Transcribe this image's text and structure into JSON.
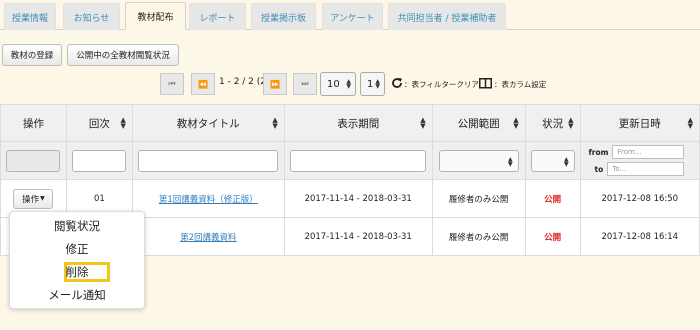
{
  "tabs": [
    "授業情報",
    "お知らせ",
    "教材配布",
    "レポート",
    "授業掲示板",
    "アンケート",
    "共同担当者 / 授業補助者"
  ],
  "toolbar": {
    "register_label": "教材の登録",
    "view_status_label": "公開中の全教材閲覧状況"
  },
  "pager": {
    "first": "⏮",
    "prev": "⏪",
    "range": "1 - 2 / 2 (2)",
    "next": "⏩",
    "last": "⏭",
    "per_page": "10",
    "page": "1",
    "filter_clear": "：表フィルタークリア",
    "column_settings": "：表カラム設定"
  },
  "table": {
    "headers": [
      "操作",
      "回次",
      "教材タイトル",
      "表示期間",
      "公開範囲",
      "状況",
      "更新日時"
    ],
    "date_filter": {
      "from_label": "from",
      "from_placeholder": "From...",
      "to_label": "to",
      "to_placeholder": "To..."
    },
    "action_button": "操作",
    "rows": [
      {
        "round": "01",
        "title": "第1回講義資料（修正版）",
        "period": "2017-11-14 - 2018-03-31",
        "scope": "履修者のみ公開",
        "status": "公開",
        "updated": "2017-12-08 16:50"
      },
      {
        "round": "",
        "title": "第2回講義資料",
        "period": "2017-11-14 - 2018-03-31",
        "scope": "履修者のみ公開",
        "status": "公開",
        "updated": "2017-12-08 16:14"
      }
    ]
  },
  "action_menu": {
    "items": [
      "閲覧状況",
      "修正",
      "削除",
      "メール通知"
    ],
    "highlighted": "削除",
    "highlight_color": "#f5c518"
  },
  "colors": {
    "background": "#fdf7e8",
    "link": "#2f7dbd",
    "tab_text": "#3f8fb8",
    "status_public": "#e0251f"
  }
}
